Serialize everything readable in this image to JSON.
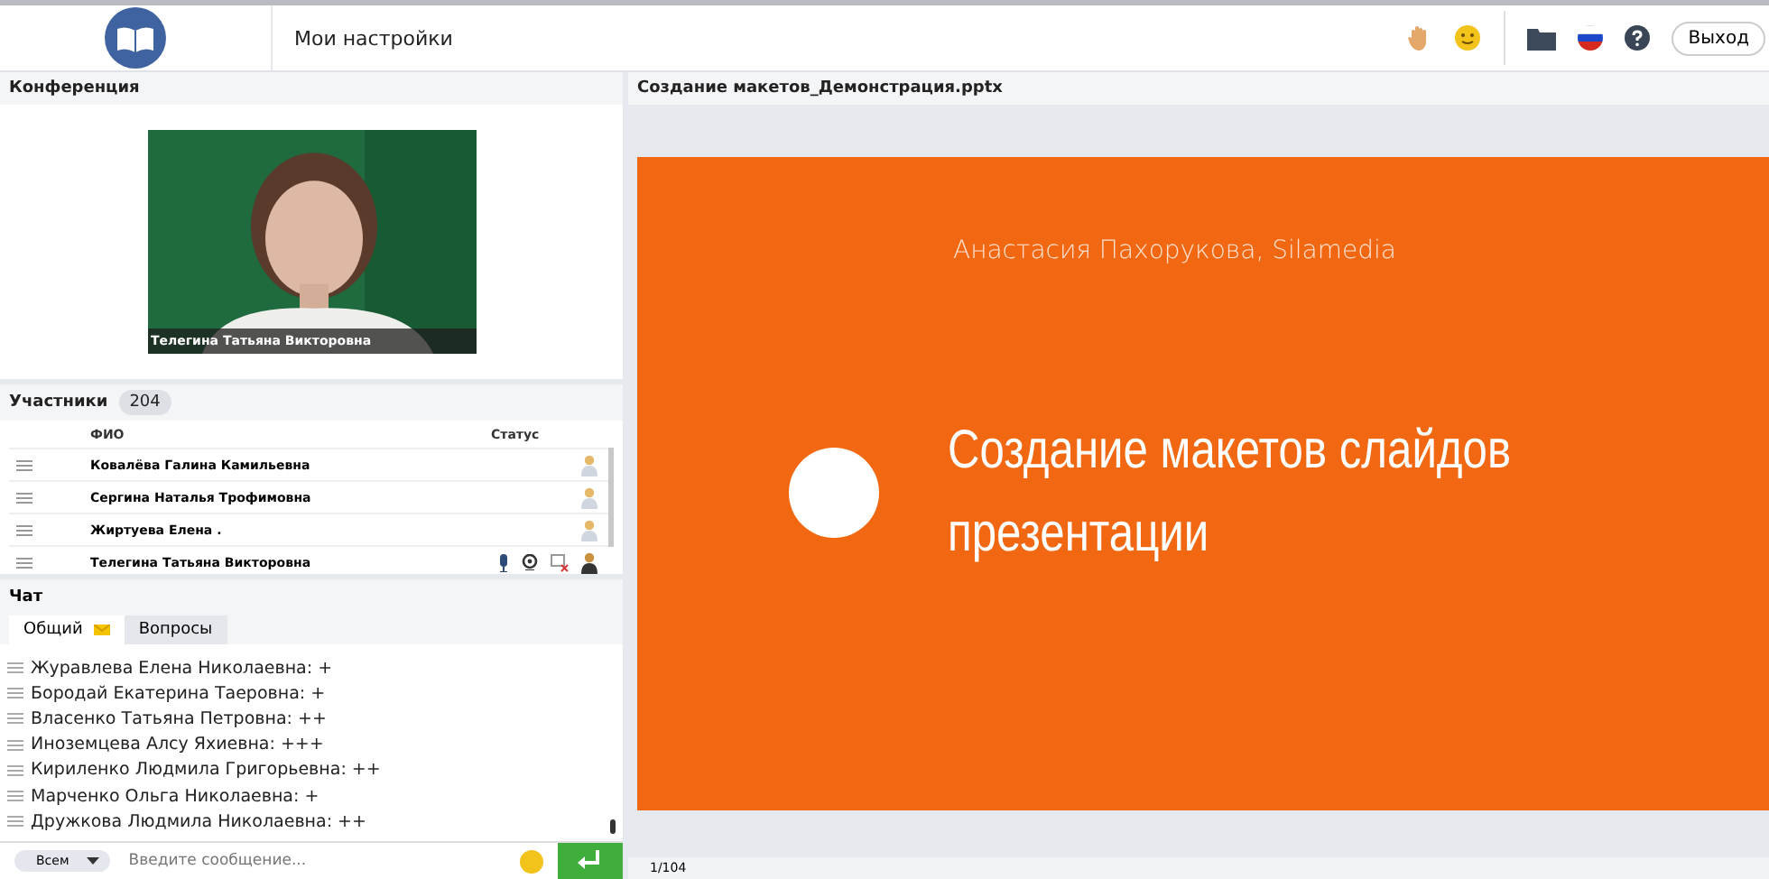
{
  "header": {
    "settings_link": "Мои настройки",
    "exit_button": "Выход"
  },
  "conference": {
    "title": "Конференция",
    "video_caption": "Телегина Татьяна Викторовна"
  },
  "participants": {
    "title": "Участники",
    "count": "204",
    "columns": [
      "ФИО",
      "Статус"
    ],
    "rows": [
      {
        "name": "Ковалёва Галина Камильевна",
        "speaker": false
      },
      {
        "name": "Сергина Наталья Трофимовна",
        "speaker": false
      },
      {
        "name": "Жиртуева Елена .",
        "speaker": false
      },
      {
        "name": "Телегина Татьяна Викторовна",
        "speaker": true
      }
    ]
  },
  "chat": {
    "title": "Чат",
    "tabs": [
      {
        "label": "Общий",
        "selected": true,
        "unread": true
      },
      {
        "label": "Вопросы",
        "selected": false,
        "unread": false
      }
    ],
    "messages": [
      "Журавлева Елена Николаевна: +",
      "Бородай Екатерина Таеровна: +",
      "Власенко Татьяна  Петровна: ++",
      "Иноземцева  Алсу  Яхиевна: +++",
      "Кириленко Людмила Григорьевна: ++",
      "Марченко Ольга Николаевна: +",
      "Дружкова Людмила Николаевна: ++"
    ],
    "recipient": "Всем",
    "placeholder": "Введите сообщение..."
  },
  "presentation": {
    "title": "Создание макетов_Демонстрация.pptx",
    "slide": {
      "author": "Анастасия Пахорукова, Silamedia",
      "heading": "Создание макетов слайдов презентации"
    },
    "page": "1/104"
  }
}
